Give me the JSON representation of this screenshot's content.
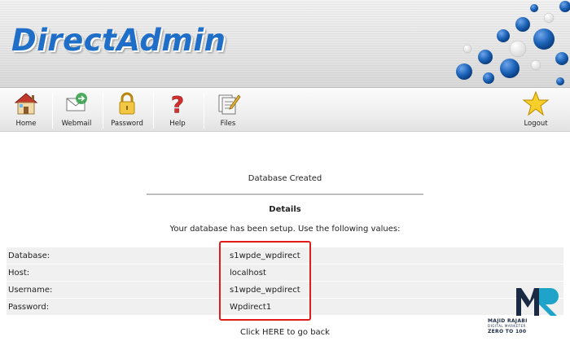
{
  "header": {
    "logo_text": "DirectAdmin"
  },
  "toolbar": {
    "items": [
      {
        "label": "Home",
        "icon": "home-icon"
      },
      {
        "label": "Webmail",
        "icon": "webmail-icon"
      },
      {
        "label": "Password",
        "icon": "lock-icon"
      },
      {
        "label": "Help",
        "icon": "question-icon"
      },
      {
        "label": "Files",
        "icon": "files-icon"
      },
      {
        "label": "Logout",
        "icon": "star-icon"
      }
    ]
  },
  "main": {
    "title": "Database Created",
    "details_heading": "Details",
    "intro": "Your database has been setup. Use the following values:",
    "rows": [
      {
        "key": "Database:",
        "value": "s1wpde_wpdirect"
      },
      {
        "key": "Host:",
        "value": "localhost"
      },
      {
        "key": "Username:",
        "value": "s1wpde_wpdirect"
      },
      {
        "key": "Password:",
        "value": "Wpdirect1"
      }
    ],
    "back_prefix": "Click ",
    "back_link": "HERE",
    "back_suffix": " to go back"
  },
  "watermark": {
    "name": "MAJID RAJABI",
    "subtitle": "DIGITAL MARKETER",
    "tagline": "ZERO TO 100"
  },
  "colors": {
    "logo_blue": "#1f6ec7",
    "dots_blue": "#1c63b8",
    "highlight_red": "#e01b1b"
  }
}
